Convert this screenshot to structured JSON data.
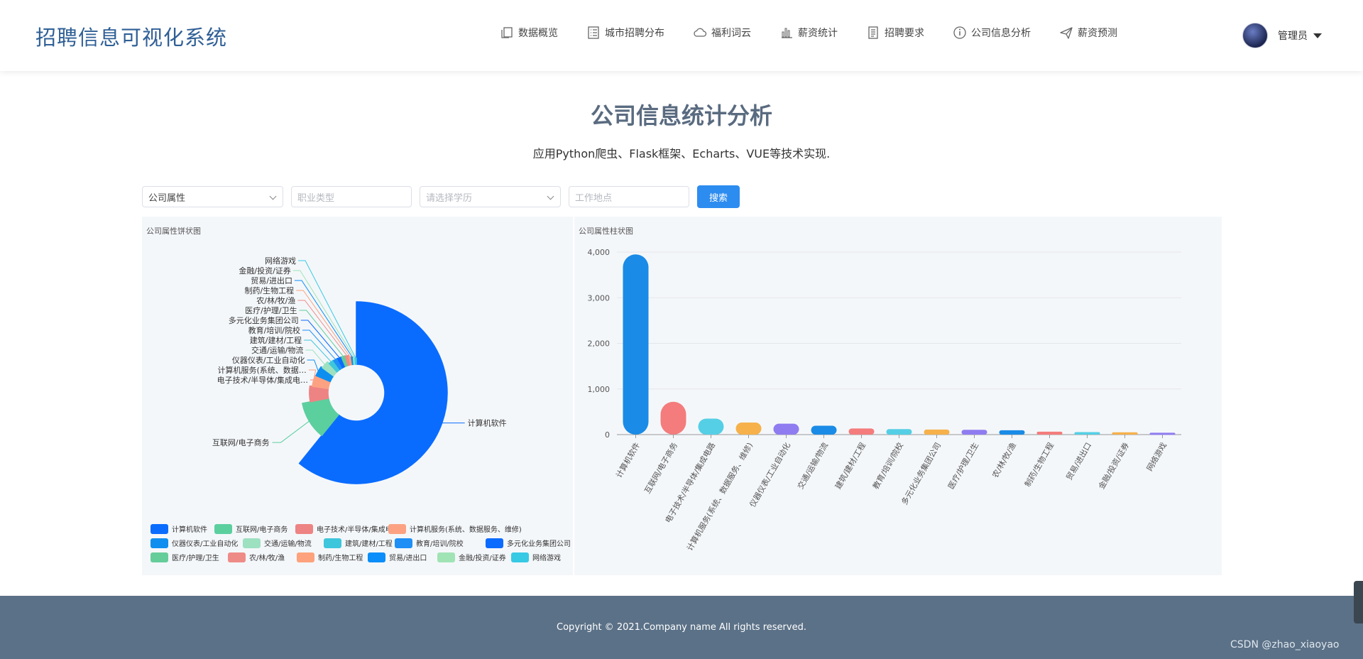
{
  "header": {
    "brand": "招聘信息可视化系统",
    "nav": [
      {
        "label": "数据概览",
        "icon": "copy-icon"
      },
      {
        "label": "城市招聘分布",
        "icon": "list-icon"
      },
      {
        "label": "福利词云",
        "icon": "cloud-icon"
      },
      {
        "label": "薪资统计",
        "icon": "bar-chart-icon"
      },
      {
        "label": "招聘要求",
        "icon": "document-icon"
      },
      {
        "label": "公司信息分析",
        "icon": "info-icon"
      },
      {
        "label": "薪资预测",
        "icon": "send-icon"
      }
    ],
    "user": "管理员"
  },
  "page": {
    "title": "公司信息统计分析",
    "subtitle": "应用Python爬虫、Flask框架、Echarts、VUE等技术实现."
  },
  "filters": {
    "type_value": "公司属性",
    "job_placeholder": "职业类型",
    "edu_placeholder": "请选择学历",
    "location_placeholder": "工作地点",
    "search_label": "搜索"
  },
  "chart_data": [
    {
      "type": "pie",
      "title": "公司属性饼状图",
      "categories": [
        "计算机软件",
        "互联网/电子商务",
        "电子技术/半导体/集成电路",
        "计算机服务(系统、数据服务、维修)",
        "仪器仪表/工业自动化",
        "交通/运输/物流",
        "建筑/建材/工程",
        "教育/培训/院校",
        "多元化业务集团公司",
        "医疗/护理/卫生",
        "农/林/牧/渔",
        "制药/生物工程",
        "贸易/进出口",
        "金融/投资/证券",
        "网络游戏"
      ],
      "values": [
        3950,
        720,
        350,
        265,
        240,
        195,
        135,
        120,
        110,
        105,
        95,
        65,
        55,
        50,
        40
      ],
      "colors": [
        "#0a6cff",
        "#5ccf9f",
        "#ee8383",
        "#fca283",
        "#0e8ff0",
        "#9de1c1",
        "#3ec6dc",
        "#1f8ff5",
        "#0c6bff",
        "#65cd9a",
        "#ef8b87",
        "#fda27c",
        "#0b8ef9",
        "#a0e4b5",
        "#38c9e4"
      ],
      "legend": [
        "计算机软件",
        "互联网/电子商务",
        "电子技术/半导体/集成电路",
        "计算机服务(系统、数据服务、维修)",
        "仪器仪表/工业自动化",
        "交通/运输/物流",
        "建筑/建材/工程",
        "教育/培训/院校",
        "多元化业务集团公司",
        "医疗/护理/卫生",
        "农/林/牧/渔",
        "制药/生物工程",
        "贸易/进出口",
        "金融/投资/证券",
        "网络游戏"
      ],
      "slice_labels": [
        "计算机软件",
        "互联网/电子商务",
        "电子技术/半导体/集成电…",
        "计算机服务(系统、数据…",
        "仪器仪表/工业自动化",
        "交通/运输/物流",
        "建筑/建材/工程",
        "教育/培训/院校",
        "多元化业务集团公司",
        "医疗/护理/卫生",
        "农/林/牧/渔",
        "制药/生物工程",
        "贸易/进出口",
        "金融/投资/证券",
        "网络游戏"
      ],
      "legend_placement": "bottom"
    },
    {
      "type": "bar",
      "title": "公司属性柱状图",
      "categories": [
        "计算机软件",
        "互联网/电子商务",
        "电子技术/半导体/集成电路",
        "计算机服务(系统、数据服务、维修)",
        "仪器仪表/工业自动化",
        "交通/运输/物流",
        "建筑/建材/工程",
        "教育/培训/院校",
        "多元化业务集团公司",
        "医疗/护理/卫生",
        "农/林/牧/渔",
        "制药/生物工程",
        "贸易/进出口",
        "金融/投资/证券",
        "网络游戏"
      ],
      "values": [
        3950,
        720,
        350,
        265,
        240,
        195,
        135,
        120,
        110,
        105,
        95,
        65,
        55,
        50,
        40
      ],
      "colors": [
        "#1a8be6",
        "#f47c7c",
        "#55cfe5",
        "#f6b14b",
        "#8f7cf0",
        "#1a8be6",
        "#f47c7c",
        "#55cfe5",
        "#f6b14b",
        "#8f7cf0",
        "#1a8be6",
        "#f47c7c",
        "#55cfe5",
        "#f6b14b",
        "#8f7cf0"
      ],
      "yticks": [
        "0",
        "1,000",
        "2,000",
        "3,000",
        "4,000"
      ],
      "ylim": [
        0,
        4000
      ],
      "grid": true
    }
  ],
  "footer": {
    "copyright": "Copyright © 2021.Company name All rights reserved.",
    "watermark": "CSDN @zhao_xiaoyao"
  }
}
